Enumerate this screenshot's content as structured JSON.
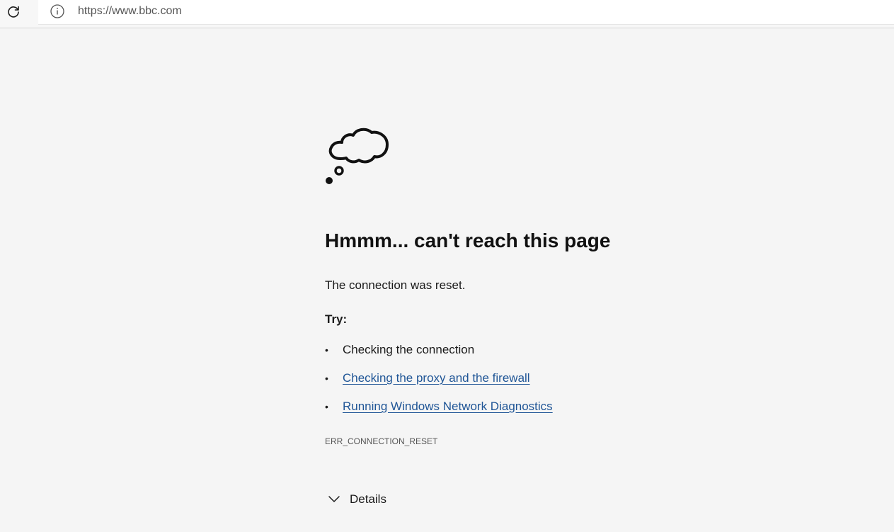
{
  "browser": {
    "url": "https://www.bbc.com",
    "refresh_icon": "refresh-icon",
    "site_info_icon": "info-icon"
  },
  "error_page": {
    "icon": "thought-cloud-icon",
    "heading": "Hmmm... can't reach this page",
    "message": "The connection was reset.",
    "try_label": "Try:",
    "suggestions": [
      {
        "text": "Checking the connection",
        "is_link": false
      },
      {
        "text": "Checking the proxy and the firewall",
        "is_link": true
      },
      {
        "text": "Running Windows Network Diagnostics",
        "is_link": true
      }
    ],
    "bullet": "•",
    "error_code": "ERR_CONNECTION_RESET",
    "details_label": "Details",
    "details_icon": "chevron-down-icon"
  },
  "colors": {
    "page_background": "#f5f5f5",
    "link": "#1f5596",
    "heading_text": "#111111",
    "muted_text": "#555555"
  }
}
